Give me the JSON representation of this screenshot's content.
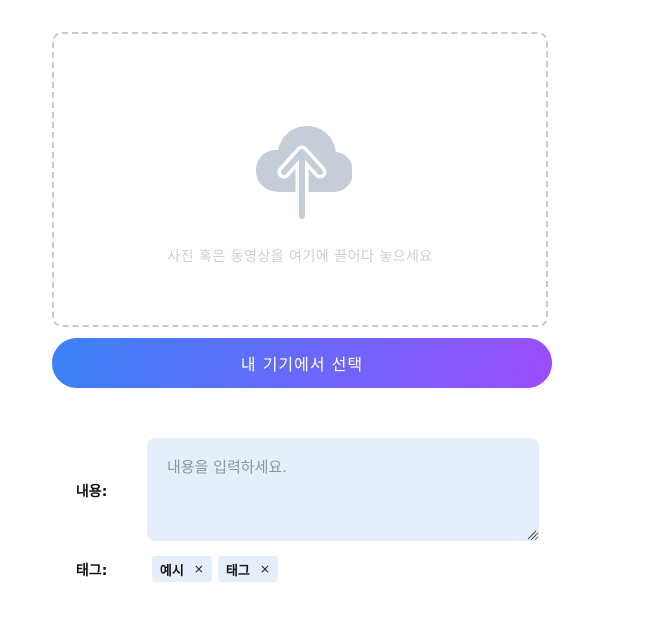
{
  "upload": {
    "icon": "cloud-upload-icon",
    "drop_hint": "사진 혹은 동영상을 여기에 끌어다 놓으세요",
    "select_button": "내 기기에서 선택",
    "button_gradient": [
      "#3b82f6",
      "#9a4cfb"
    ]
  },
  "form": {
    "content_label": "내용:",
    "content_placeholder": "내용을 입력하세요.",
    "content_value": "",
    "tags_label": "태그:",
    "tags": [
      {
        "label": "예시",
        "remove": "×"
      },
      {
        "label": "태그",
        "remove": "×"
      }
    ]
  }
}
